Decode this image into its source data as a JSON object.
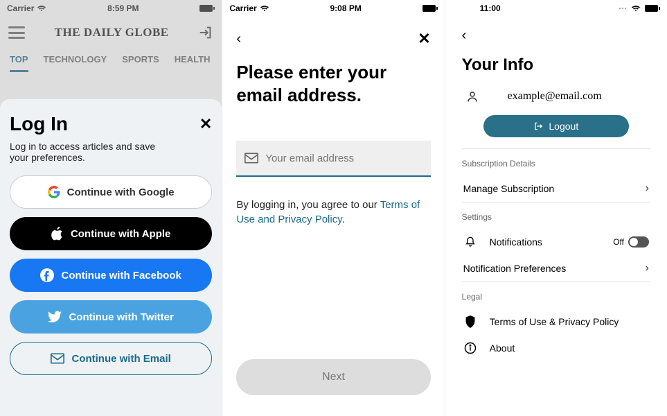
{
  "screen1": {
    "status": {
      "carrier": "Carrier",
      "time": "8:59 PM"
    },
    "brand": "THE DAILY GLOBE",
    "tabs": [
      "TOP",
      "TECHNOLOGY",
      "SPORTS",
      "HEALTH"
    ],
    "sheet": {
      "title": "Log In",
      "desc": "Log in to access articles and save your preferences.",
      "google": "Continue with Google",
      "apple": "Continue with Apple",
      "facebook": "Continue with Facebook",
      "twitter": "Continue with Twitter",
      "email": "Continue with Email"
    }
  },
  "screen2": {
    "status": {
      "carrier": "Carrier",
      "time": "9:08 PM"
    },
    "title": "Please enter your email address.",
    "placeholder": "Your email address",
    "legal_prefix": "By logging in, you agree to our ",
    "legal_link": "Terms of Use and Privacy Policy",
    "next": "Next"
  },
  "screen3": {
    "status": {
      "time": "11:00"
    },
    "title": "Your Info",
    "email": "example@email.com",
    "logout": "Logout",
    "subscription_label": "Subscription Details",
    "manage_sub": "Manage Subscription",
    "settings_label": "Settings",
    "notifications": "Notifications",
    "notifications_state": "Off",
    "notif_prefs": "Notification Preferences",
    "legal_label": "Legal",
    "terms": "Terms of Use & Privacy Policy",
    "about": "About"
  }
}
